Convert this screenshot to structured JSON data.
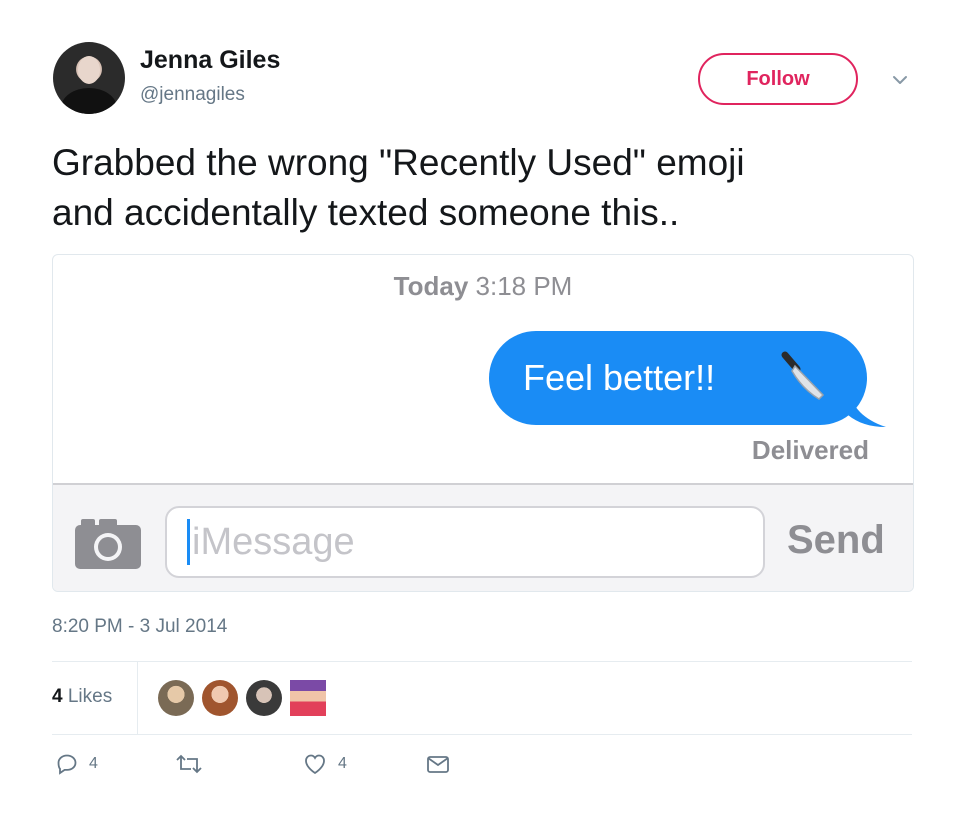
{
  "user": {
    "name": "Jenna Giles",
    "handle": "@jennagiles",
    "avatar_icon": "profile-photo"
  },
  "follow_label": "Follow",
  "tweet_text_line1": "Grabbed the wrong \"Recently Used\" emoji",
  "tweet_text_line2": "and accidentally texted someone this..",
  "media": {
    "time_day": "Today",
    "time_clock": "3:18 PM",
    "bubble_text": "Feel better!!",
    "emoji": "knife-emoji",
    "status": "Delivered",
    "input_placeholder": "iMessage",
    "send_label": "Send",
    "camera_icon": "camera-icon"
  },
  "timestamp": "8:20 PM - 3 Jul 2014",
  "likes": {
    "count": "4",
    "label": "Likes"
  },
  "actions": {
    "reply_count": "4",
    "retweet_count": "",
    "like_count": "4"
  },
  "colors": {
    "follow_accent": "#e0245e",
    "imessage_blue": "#1a8cf5",
    "muted_text": "#657786"
  }
}
